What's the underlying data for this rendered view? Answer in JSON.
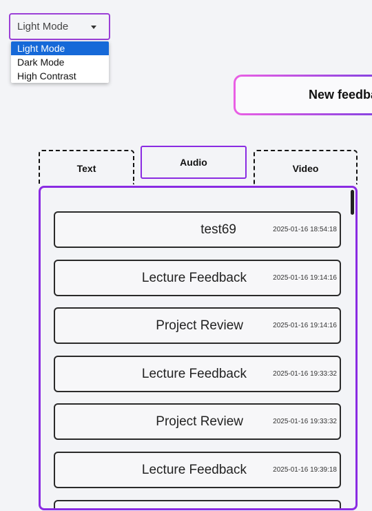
{
  "theme_select": {
    "value": "Light Mode",
    "options": [
      "Light Mode",
      "Dark Mode",
      "High Contrast"
    ],
    "selected_index": 0
  },
  "new_feedback_button": {
    "label": "New feedback"
  },
  "tabs": [
    {
      "label": "Text",
      "active": false
    },
    {
      "label": "Audio",
      "active": true
    },
    {
      "label": "Video",
      "active": false
    }
  ],
  "feedback_list": [
    {
      "title": "test69",
      "timestamp": "2025-01-16 18:54:18"
    },
    {
      "title": "Lecture Feedback",
      "timestamp": "2025-01-16 19:14:16"
    },
    {
      "title": "Project Review",
      "timestamp": "2025-01-16 19:14:16"
    },
    {
      "title": "Lecture Feedback",
      "timestamp": "2025-01-16 19:33:32"
    },
    {
      "title": "Project Review",
      "timestamp": "2025-01-16 19:33:32"
    },
    {
      "title": "Lecture Feedback",
      "timestamp": "2025-01-16 19:39:18"
    },
    {
      "title": "",
      "timestamp": ""
    }
  ],
  "colors": {
    "accent_purple": "#8a2be2",
    "select_border": "#9b3fd6",
    "gradient_start": "#ea5fe4",
    "gradient_end": "#7b3fe0",
    "selected_option": "#1669d8"
  }
}
